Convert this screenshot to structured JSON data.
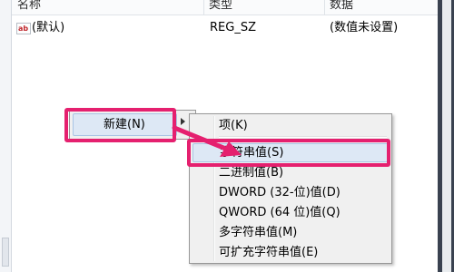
{
  "columns": {
    "name": "名称",
    "type": "类型",
    "data": "数据"
  },
  "value_row": {
    "icon": "ab-icon",
    "name": "(默认)",
    "type": "REG_SZ",
    "data": "(数值未设置)"
  },
  "context_menu": {
    "new_label": "新建(N)"
  },
  "submenu": {
    "items": [
      "项(K)",
      "字符串值(S)",
      "二进制值(B)",
      "DWORD (32-位)值(D)",
      "QWORD (64 位)值(Q)",
      "多字符串值(M)",
      "可扩充字符串值(E)"
    ]
  },
  "annotation_color": "#e5206f",
  "highlight_color": "#dde8f5"
}
